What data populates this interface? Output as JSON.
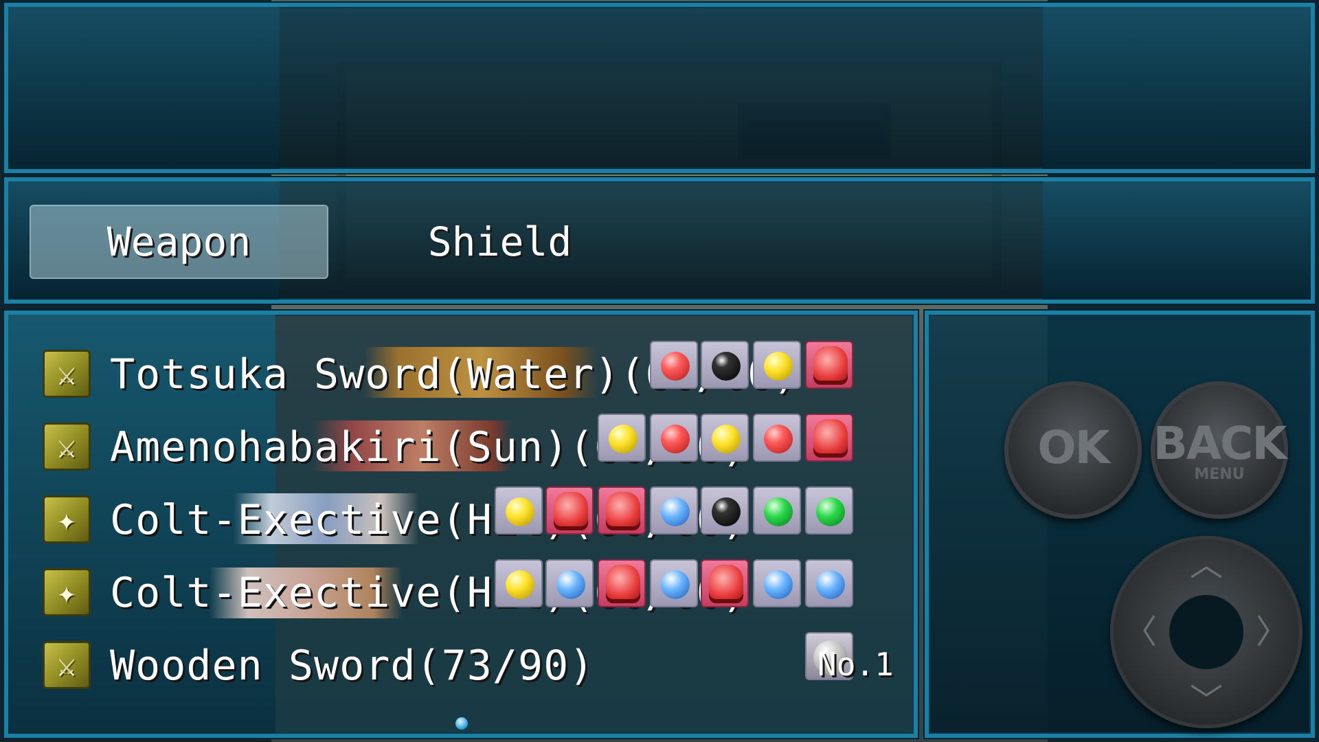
{
  "categories": {
    "weapon_label": "Weapon",
    "shield_label": "Shield",
    "selected": "Weapon"
  },
  "items": [
    {
      "icon": "sword-icon",
      "name": "Totsuka Sword(Water)(60/60)",
      "slots": [
        "red-orb",
        "black-orb",
        "yellow-orb",
        "red-fist"
      ]
    },
    {
      "icon": "sword-icon",
      "name": "Amenohabakiri(Sun)(60/60)",
      "slots": [
        "yellow-orb",
        "red-orb",
        "yellow-orb",
        "red-orb",
        "red-fist"
      ]
    },
    {
      "icon": "gun-icon",
      "name": "Colt-Exective(Hit)(60/60)",
      "slots": [
        "yellow-orb",
        "red-fist",
        "red-fist",
        "blue-orb",
        "black-orb",
        "green-orb",
        "green-orb"
      ]
    },
    {
      "icon": "gun-icon",
      "name": "Colt-Exective(Hit)(60/60)",
      "slots": [
        "yellow-orb",
        "blue-orb",
        "red-fist",
        "blue-orb",
        "red-fist",
        "blue-orb",
        "blue-orb"
      ]
    },
    {
      "icon": "sword-icon",
      "name": "Wooden Sword(73/90)",
      "slots": [
        "grey-sphere"
      ],
      "number_label": "No.1"
    }
  ],
  "controls": {
    "ok_label": "OK",
    "back_label": "BACK",
    "back_sub_label": "MENU"
  },
  "colors": {
    "frame": "#1d7fa3",
    "selected_tab": "#aac8d2",
    "item_icon": "#c8c04a"
  }
}
